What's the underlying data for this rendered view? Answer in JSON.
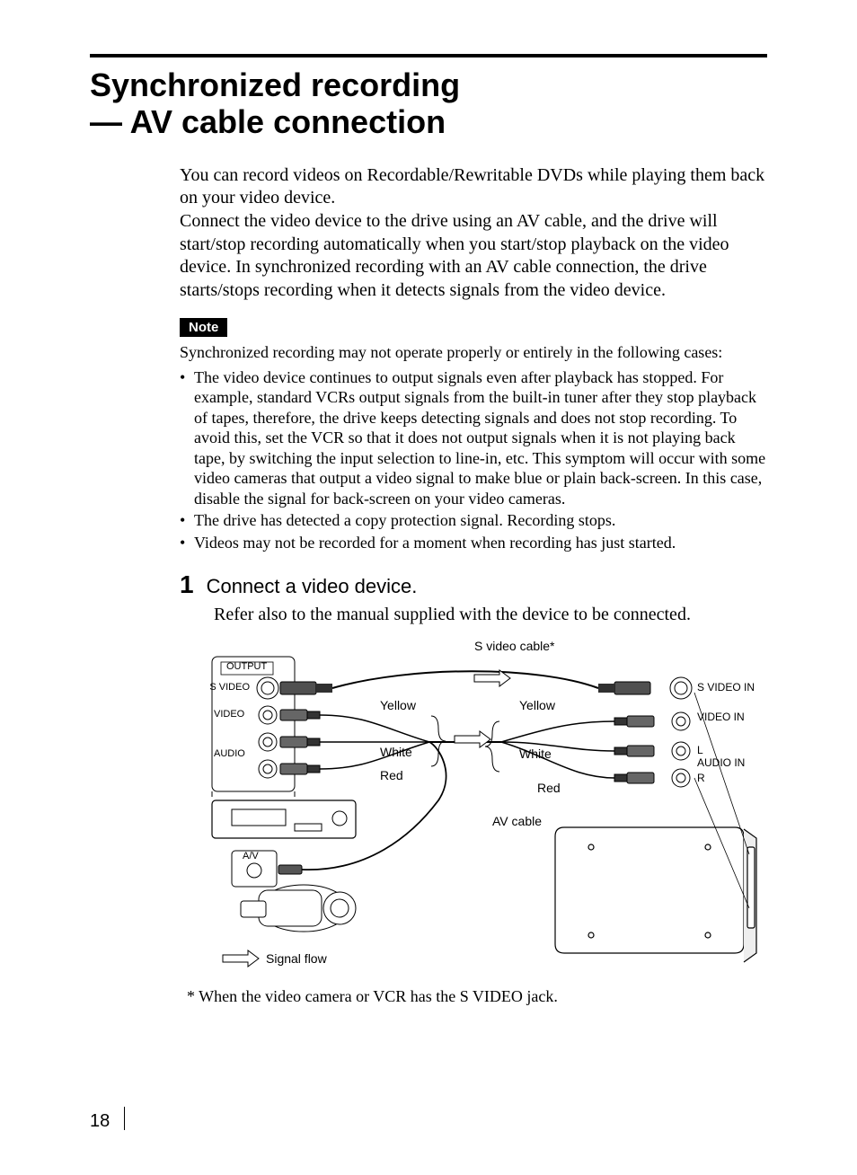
{
  "title_line1": "Synchronized recording",
  "title_line2": "— AV cable connection",
  "intro": "You can record videos on Recordable/Rewritable DVDs while playing them back on your video device.\nConnect the video device to the drive using an AV cable, and the drive will start/stop recording automatically when you start/stop playback on the video device. In synchronized recording with an AV cable connection, the drive starts/stops recording when it detects signals from the video device.",
  "note_label": "Note",
  "note_intro": "Synchronized recording may not operate properly or entirely in the following cases:",
  "note_items": [
    "The video device continues to output signals even after playback has stopped. For example, standard VCRs output signals from the built-in tuner after they stop playback of tapes, therefore, the drive keeps detecting signals and does not stop recording. To avoid this, set the VCR so that it does not output signals when it is not playing back tape, by switching the input selection to line-in, etc. This symptom will occur with some video cameras that output a video signal to make blue or plain back-screen. In this case, disable the signal for back-screen on your video cameras.",
    "The drive has detected a copy protection signal. Recording stops.",
    "Videos may not be recorded for a moment when recording has just started."
  ],
  "step": {
    "number": "1",
    "title": "Connect a video device.",
    "subtitle": "Refer also to the manual supplied with the device to be connected."
  },
  "diagram": {
    "top_label": "S video cable*",
    "left_box_title": "OUTPUT",
    "left_ports": {
      "svideo": "S VIDEO",
      "video": "VIDEO",
      "audio": "AUDIO"
    },
    "right_ports": {
      "svideo": "S VIDEO IN",
      "video": "VIDEO IN",
      "audio": "AUDIO IN",
      "l": "L",
      "r": "R"
    },
    "colors_left": {
      "yellow": "Yellow",
      "white": "White",
      "red": "Red"
    },
    "colors_right": {
      "yellow": "Yellow",
      "white": "White",
      "red": "Red"
    },
    "av_cable": "AV cable",
    "av_port": "A/V",
    "signal_flow": "Signal flow"
  },
  "footnote": "* When the video camera or VCR has the S VIDEO jack.",
  "page_number": "18"
}
